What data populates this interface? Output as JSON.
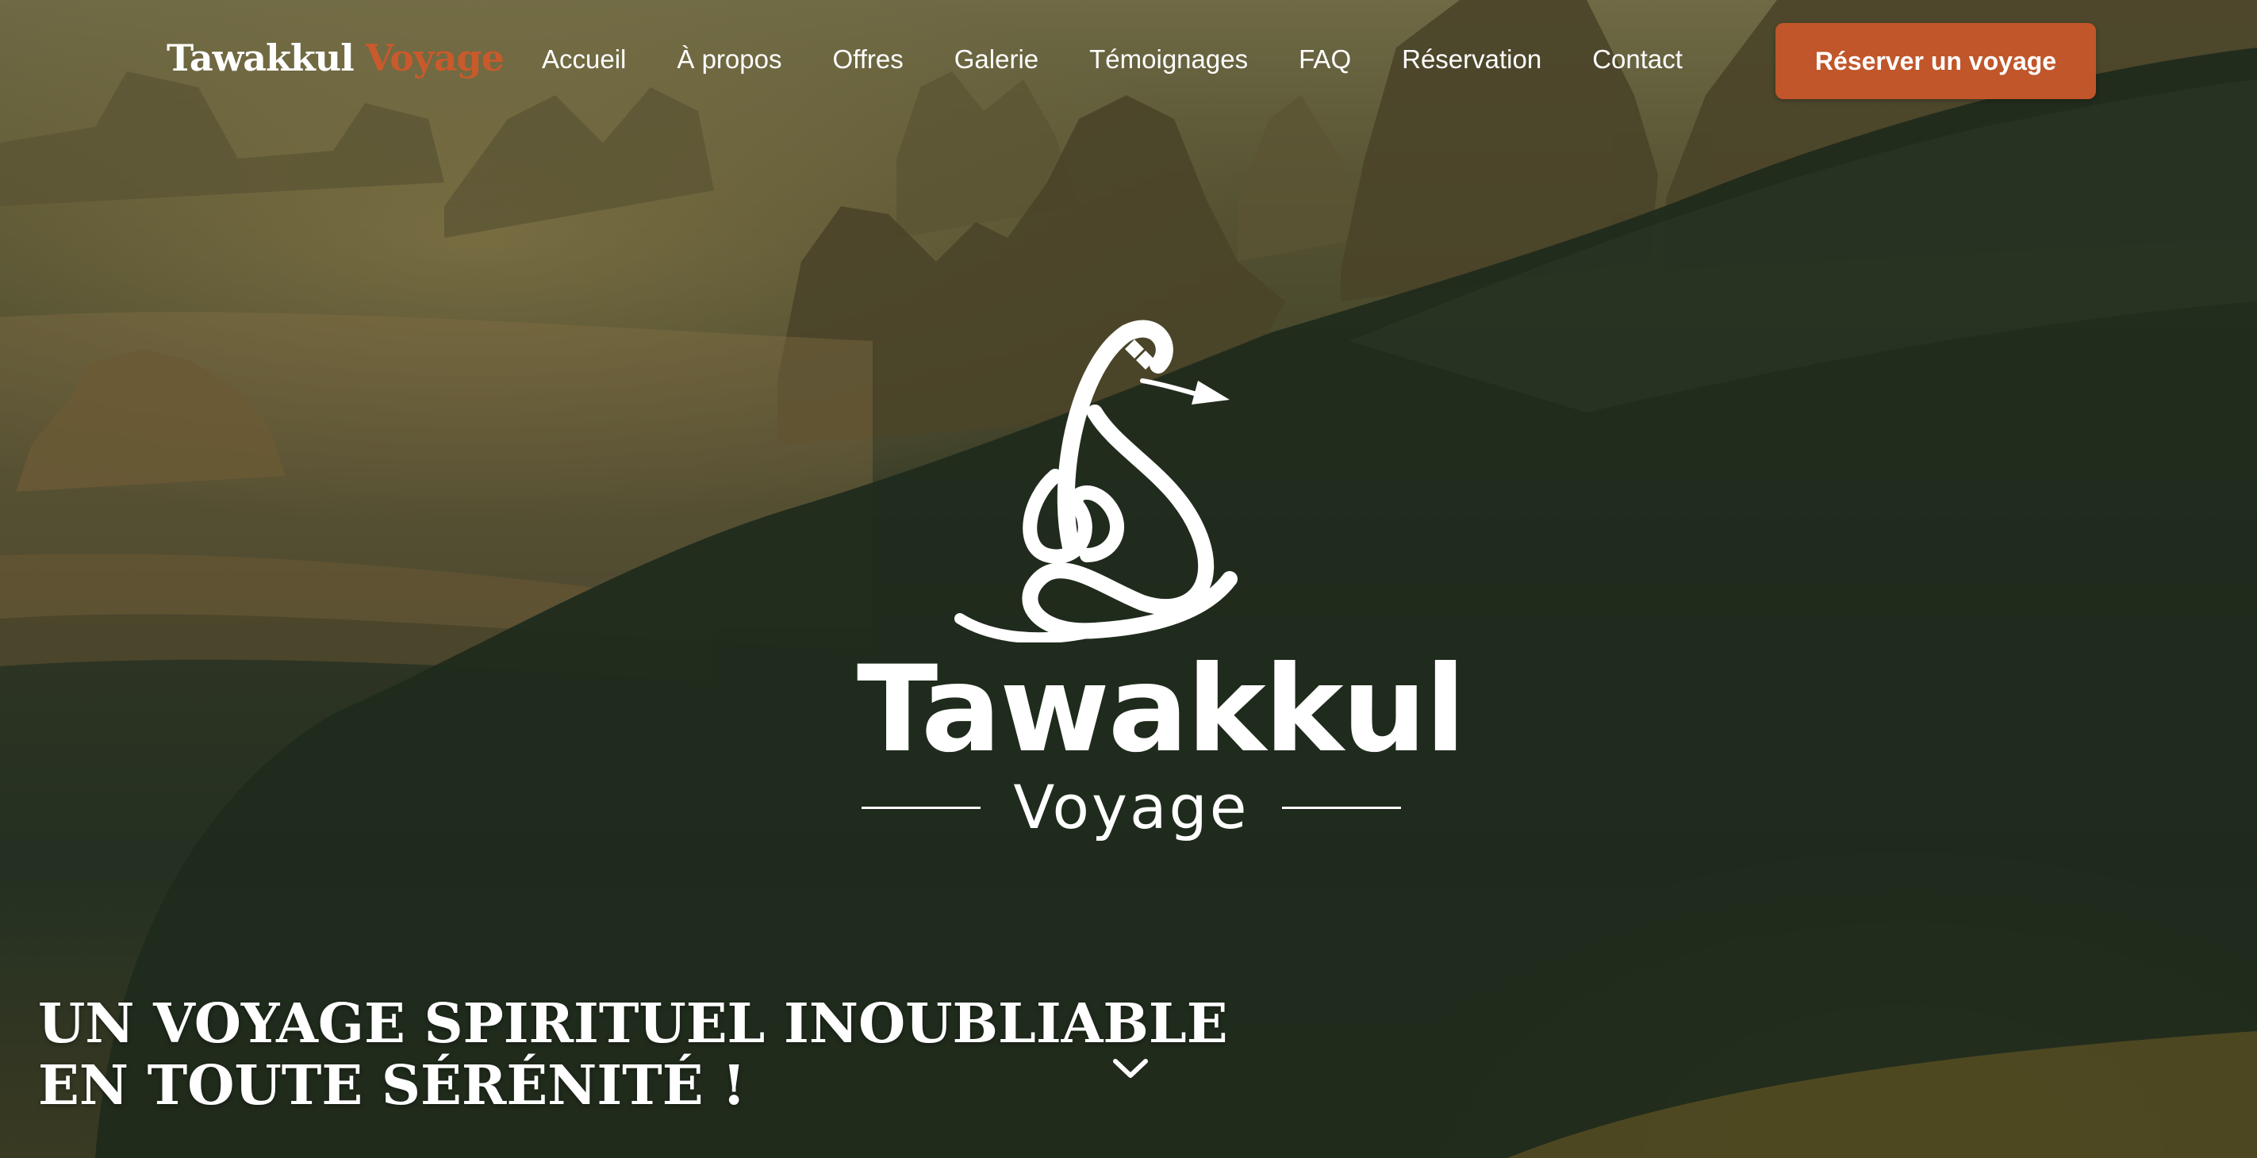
{
  "navbar": {
    "brand": {
      "primary": "Tawakkul",
      "accent": "Voyage"
    },
    "links": [
      {
        "id": "accueil",
        "label": "Accueil"
      },
      {
        "id": "a-propos",
        "label": "À propos"
      },
      {
        "id": "offres",
        "label": "Offres"
      },
      {
        "id": "galerie",
        "label": "Galerie"
      },
      {
        "id": "temoignages",
        "label": "Témoignages"
      },
      {
        "id": "faq",
        "label": "FAQ"
      },
      {
        "id": "reservation",
        "label": "Réservation"
      },
      {
        "id": "contact",
        "label": "Contact"
      }
    ],
    "cta_label": "Réserver un voyage"
  },
  "hero": {
    "logo": {
      "wordmark": "Tawakkul",
      "subtitle": "Voyage"
    },
    "headline_line1": "UN VOYAGE SPIRITUEL INOUBLIABLE",
    "headline_line2": "EN TOUTE SÉRÉNITÉ !",
    "scroll_icon": "chevron-down-icon"
  },
  "colors": {
    "accent": "#c0562a",
    "text": "#ffffff",
    "brand_accent": "#c85a2b"
  }
}
